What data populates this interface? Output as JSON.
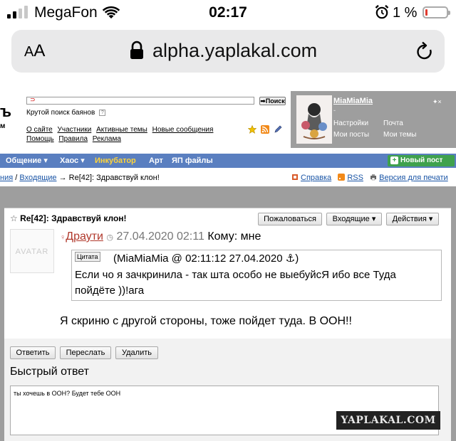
{
  "status_bar": {
    "carrier": "MegaFon",
    "time": "02:17",
    "battery_pct": "1 %",
    "signal_bars_on": 2,
    "signal_bars_total": 4
  },
  "browser": {
    "text_size_label": "AA",
    "url": "alpha.yaplakal.com"
  },
  "site_header": {
    "logo_fragment": "ъ",
    "logo_fragment_2": "м",
    "search_placeholder": "",
    "search_button": "Поиск",
    "search_hint": "Крутой поиск баянов",
    "search_hint_q": "?",
    "links_row1": [
      "О сайте",
      "Участники",
      "Активные темы",
      "Новые сообщения"
    ],
    "links_row2": [
      "Помощь",
      "Правила",
      "Реклама"
    ]
  },
  "user_panel": {
    "username": "MiaMiaMia",
    "dot": "-",
    "settings": "Настройки",
    "mail": "Почта",
    "my_posts": "Мои посты",
    "my_topics": "Мои темы"
  },
  "nav": {
    "items": [
      "Общение ▾",
      "Хаос ▾",
      "Инкубатор",
      "Арт",
      "ЯП файлы"
    ],
    "new_post": "Новый пост"
  },
  "breadcrumb": {
    "part1": "ния",
    "sep1": " / ",
    "part2": "Входящие",
    "sep2": " → ",
    "current": "Re[42]: Здравствуй клон!"
  },
  "right_links": {
    "help": "Справка",
    "rss": "RSS",
    "print": "Версия для печати"
  },
  "message": {
    "title": "Re[42]: Здравствуй клон!",
    "btn_complain": "Пожаловаться",
    "btn_inbox": "Входящие ▾",
    "btn_actions": "Действия ▾",
    "avatar_placeholder": "AVATAR",
    "author": "Драути",
    "date": "27.04.2020 02:11",
    "to_label": "Кому: мне",
    "quote_label": "Цитата",
    "quote_header": "(MiaMiaMia @ 02:11:12 27.04.2020 ⚓)",
    "quote_text": "Если чо я зачкринила - так шта особо не выебуйсЯ ибо все Туда пойдёте ))!ага",
    "body": "Я скриню с другой стороны, тоже пойдет туда. В ООН!!",
    "btn_reply": "Ответить",
    "btn_forward": "Переслать",
    "btn_delete": "Удалить"
  },
  "quick_reply": {
    "title": "Быстрый ответ",
    "value": "ты хочешь в ООН? Будет тебе ООН"
  },
  "watermark": "YAPLAKAL.COM",
  "colors": {
    "nav_bg": "#5a7fc0",
    "nav_highlight": "#ffd43a",
    "new_post_bg": "#3fa14d",
    "link": "#1a55a6",
    "author": "#b0382b",
    "panel_grey": "#9e9e9e"
  }
}
